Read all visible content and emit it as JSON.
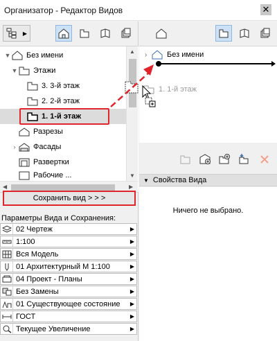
{
  "window": {
    "title": "Организатор - Редактор Видов",
    "close_glyph": "✕"
  },
  "left_tree": {
    "items": [
      {
        "label": "Без имени",
        "icon": "project-icon"
      },
      {
        "label": "Этажи",
        "icon": "stories-folder-icon"
      },
      {
        "label": "3. 3-й этаж",
        "icon": "story-icon"
      },
      {
        "label": "2. 2-й этаж",
        "icon": "story-icon"
      },
      {
        "label": "1. 1-й этаж",
        "icon": "story-icon",
        "selected": true
      },
      {
        "label": "Разрезы",
        "icon": "sections-icon"
      },
      {
        "label": "Фасады",
        "icon": "elevations-icon"
      },
      {
        "label": "Развертки",
        "icon": "interior-elevations-icon"
      },
      {
        "label": "Рабочие ...",
        "icon": "worksheets-icon"
      }
    ]
  },
  "save_button": {
    "label": "Сохранить вид > > >"
  },
  "params": {
    "label": "Параметры Вида и Сохранения:",
    "rows": [
      {
        "value": "02 Чертеж",
        "icon": "layers-icon"
      },
      {
        "value": "1:100",
        "icon": "scale-icon"
      },
      {
        "value": "Вся Модель",
        "icon": "structure-display-icon"
      },
      {
        "value": "01 Архитектурный М 1:100",
        "icon": "pen-set-icon"
      },
      {
        "value": "04 Проект - Планы",
        "icon": "model-view-options-icon"
      },
      {
        "value": "Без Замены",
        "icon": "graphic-override-icon"
      },
      {
        "value": "01 Существующее состояние",
        "icon": "renovation-filter-icon"
      },
      {
        "value": "ГОСТ",
        "icon": "dimensioning-icon"
      },
      {
        "value": "Текущее Увеличение",
        "icon": "zoom-icon"
      }
    ]
  },
  "right_tree": {
    "root": "Без имени",
    "drag_ghost": "1. 1-й этаж"
  },
  "right_buttons": [
    "new-folder-icon",
    "clone-folder-icon",
    "new-view-icon",
    "insert-view-icon",
    "delete-icon"
  ],
  "props": {
    "header": "Свойства Вида",
    "empty_text": "Ничего не выбрано."
  },
  "colors": {
    "highlight_red": "#e0242b",
    "active_blue": "#cde2f7"
  }
}
